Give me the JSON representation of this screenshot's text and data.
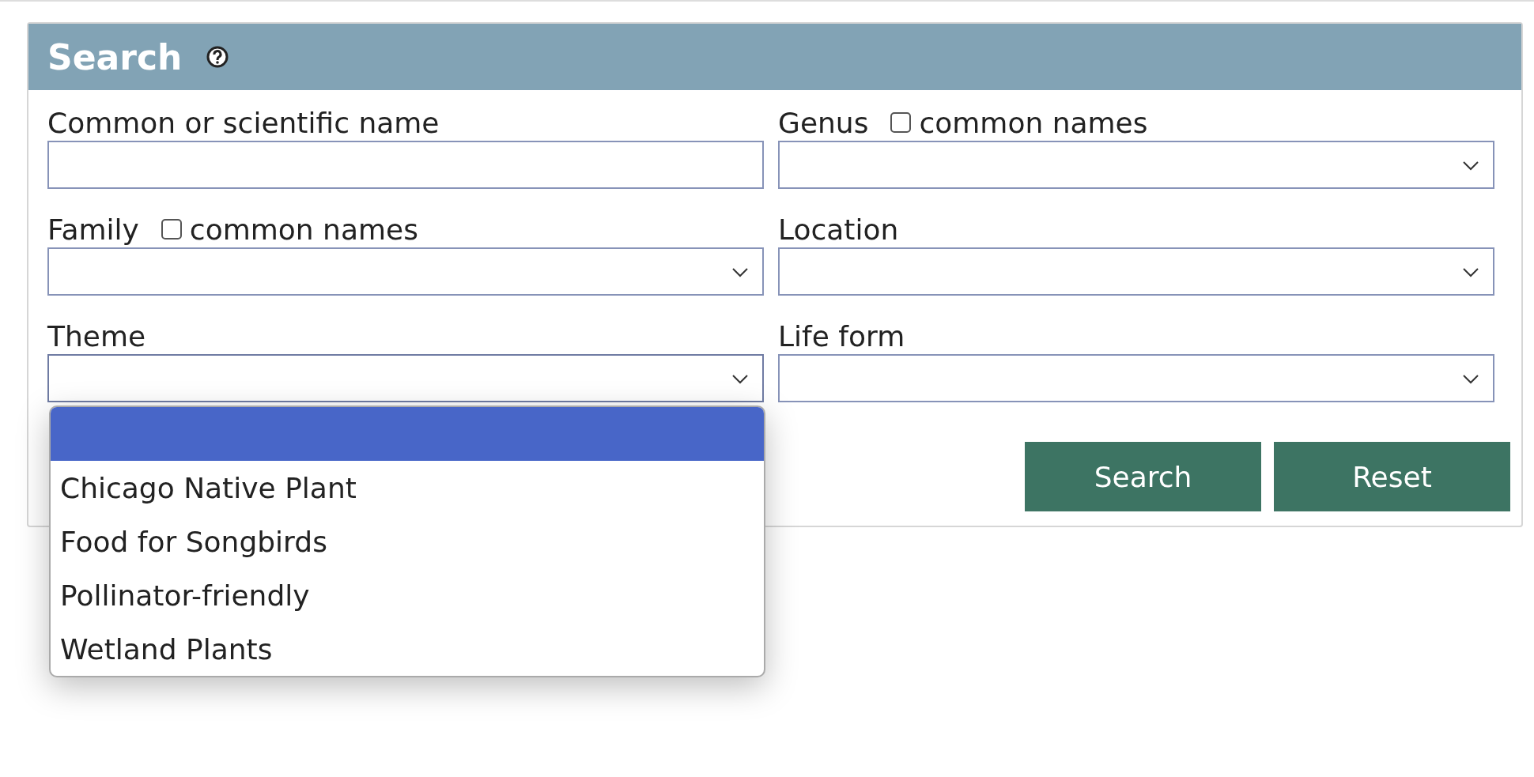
{
  "panel": {
    "title": "Search"
  },
  "fields": [
    {
      "kind": "text",
      "label": "Common or scientific name"
    },
    {
      "kind": "select",
      "label": "Genus",
      "checkbox": {
        "label": "common names",
        "checked": false
      },
      "expanded": false
    },
    {
      "kind": "select",
      "label": "Family",
      "checkbox": {
        "label": "common names",
        "checked": false
      },
      "expanded": false
    },
    {
      "kind": "select",
      "label": "Location",
      "expanded": false
    },
    {
      "kind": "select",
      "label": "Theme",
      "expanded": true,
      "blank_option": {
        "highlighted": true
      },
      "options": [
        {
          "label": "Chicago Native Plant",
          "highlighted": false
        },
        {
          "label": "Food for Songbirds",
          "highlighted": false
        },
        {
          "label": "Pollinator-friendly",
          "highlighted": false
        },
        {
          "label": "Wetland Plants",
          "highlighted": false
        }
      ]
    },
    {
      "kind": "select",
      "label": "Life form",
      "expanded": false
    }
  ],
  "buttons": [
    {
      "label": "Search"
    },
    {
      "label": "Reset"
    }
  ]
}
